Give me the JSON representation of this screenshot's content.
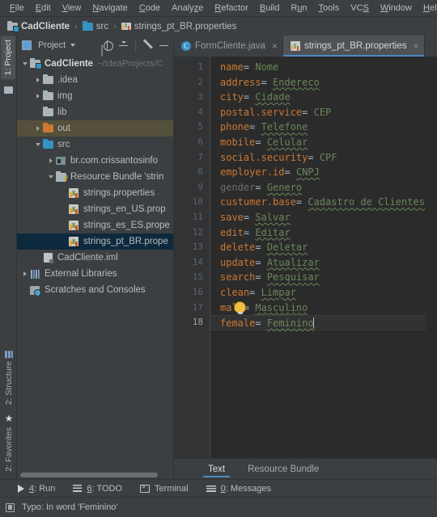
{
  "window": {
    "menu": [
      {
        "label": "File",
        "mnemonic": "F"
      },
      {
        "label": "Edit",
        "mnemonic": "E"
      },
      {
        "label": "View",
        "mnemonic": "V"
      },
      {
        "label": "Navigate",
        "mnemonic": "N"
      },
      {
        "label": "Code",
        "mnemonic": "C"
      },
      {
        "label": "Analyze",
        "mnemonic": "z"
      },
      {
        "label": "Refactor",
        "mnemonic": "R"
      },
      {
        "label": "Build",
        "mnemonic": "B"
      },
      {
        "label": "Run",
        "mnemonic": "u"
      },
      {
        "label": "Tools",
        "mnemonic": "T"
      },
      {
        "label": "VCS",
        "mnemonic": "S"
      },
      {
        "label": "Window",
        "mnemonic": "W"
      },
      {
        "label": "Help",
        "mnemonic": "H"
      }
    ]
  },
  "breadcrumb": {
    "items": [
      {
        "label": "CadCliente",
        "icon": "module-folder-icon"
      },
      {
        "label": "src",
        "icon": "source-folder-icon"
      },
      {
        "label": "strings_pt_BR.properties",
        "icon": "properties-file-icon"
      }
    ],
    "separator": "›"
  },
  "rail": {
    "project_label": "1: Project",
    "project_mnemonic": "1",
    "structure_label": "2: Structure",
    "structure_mnemonic": "2",
    "favorites_label": "2: Favorites",
    "favorites_mnemonic": "2"
  },
  "project_panel": {
    "title": "Project",
    "toolbar": [
      {
        "name": "select-opened-file-icon",
        "label": "Select Opened File"
      },
      {
        "name": "collapse-all-icon",
        "label": "Collapse All"
      },
      {
        "name": "settings-gear-icon",
        "label": "Settings"
      },
      {
        "name": "hide-icon",
        "label": "Hide"
      }
    ],
    "tree": [
      {
        "label": "CadCliente",
        "path": "~/IdeaProjects/C",
        "depth": 0,
        "arrow": "open",
        "icon": "module-folder-icon",
        "bold": true,
        "state": "normal"
      },
      {
        "label": ".idea",
        "path": "",
        "depth": 1,
        "arrow": "closed",
        "icon": "folder-icon",
        "bold": false,
        "state": "normal"
      },
      {
        "label": "img",
        "path": "",
        "depth": 1,
        "arrow": "closed",
        "icon": "folder-icon",
        "bold": false,
        "state": "normal"
      },
      {
        "label": "lib",
        "path": "",
        "depth": 1,
        "arrow": "none",
        "icon": "folder-icon",
        "bold": false,
        "state": "normal"
      },
      {
        "label": "out",
        "path": "",
        "depth": 1,
        "arrow": "closed",
        "icon": "output-folder-icon",
        "bold": false,
        "state": "highlighted"
      },
      {
        "label": "src",
        "path": "",
        "depth": 1,
        "arrow": "open",
        "icon": "source-folder-icon",
        "bold": false,
        "state": "normal"
      },
      {
        "label": "br.com.crissantosinfo",
        "path": "",
        "depth": 2,
        "arrow": "closed",
        "icon": "package-icon",
        "bold": false,
        "state": "normal"
      },
      {
        "label": "Resource Bundle 'strin",
        "path": "",
        "depth": 2,
        "arrow": "open",
        "icon": "resource-bundle-icon",
        "bold": false,
        "state": "normal"
      },
      {
        "label": "strings.properties",
        "path": "",
        "depth": 3,
        "arrow": "none",
        "icon": "properties-file-icon",
        "bold": false,
        "state": "normal"
      },
      {
        "label": "strings_en_US.prop",
        "path": "",
        "depth": 3,
        "arrow": "none",
        "icon": "properties-file-icon",
        "bold": false,
        "state": "normal"
      },
      {
        "label": "strings_es_ES.prope",
        "path": "",
        "depth": 3,
        "arrow": "none",
        "icon": "properties-file-icon",
        "bold": false,
        "state": "normal"
      },
      {
        "label": "strings_pt_BR.prope",
        "path": "",
        "depth": 3,
        "arrow": "none",
        "icon": "properties-file-icon",
        "bold": false,
        "state": "selected"
      },
      {
        "label": "CadCliente.iml",
        "path": "",
        "depth": 1,
        "arrow": "none",
        "icon": "iml-file-icon",
        "bold": false,
        "state": "normal"
      },
      {
        "label": "External Libraries",
        "path": "",
        "depth": 0,
        "arrow": "closed",
        "icon": "libraries-icon",
        "bold": false,
        "state": "normal"
      },
      {
        "label": "Scratches and Consoles",
        "path": "",
        "depth": 0,
        "arrow": "none",
        "icon": "scratches-icon",
        "bold": false,
        "state": "normal"
      }
    ]
  },
  "editor": {
    "tabs": [
      {
        "label": "FormCliente.java",
        "icon": "java-class-icon",
        "active": false,
        "close": "×"
      },
      {
        "label": "strings_pt_BR.properties",
        "icon": "properties-file-icon",
        "active": true,
        "close": "×"
      }
    ],
    "lines": [
      {
        "num": "1",
        "key": "name",
        "value": "Nome",
        "typo": false,
        "dim": false
      },
      {
        "num": "2",
        "key": "address",
        "value": "Endereco",
        "typo": true,
        "dim": false
      },
      {
        "num": "3",
        "key": "city",
        "value": "Cidade",
        "typo": true,
        "dim": false
      },
      {
        "num": "4",
        "key": "postal.service",
        "value": "CEP",
        "typo": false,
        "dim": false
      },
      {
        "num": "5",
        "key": "phone",
        "value": "Telefone",
        "typo": true,
        "dim": false
      },
      {
        "num": "6",
        "key": "mobile",
        "value": "Celular",
        "typo": true,
        "dim": false
      },
      {
        "num": "7",
        "key": "social.security",
        "value": "CPF",
        "typo": false,
        "dim": false
      },
      {
        "num": "8",
        "key": "employer.id",
        "value": "CNPJ",
        "typo": true,
        "dim": false
      },
      {
        "num": "9",
        "key": "gender",
        "value": "Genero",
        "typo": true,
        "dim": true
      },
      {
        "num": "10",
        "key": "custumer.base",
        "value": "Cadastro de Clientes",
        "typo": true,
        "dim": false
      },
      {
        "num": "11",
        "key": "save",
        "value": "Salvar",
        "typo": true,
        "dim": false
      },
      {
        "num": "12",
        "key": "edit",
        "value": "Editar",
        "typo": true,
        "dim": false
      },
      {
        "num": "13",
        "key": "delete",
        "value": "Deletar",
        "typo": true,
        "dim": false
      },
      {
        "num": "14",
        "key": "update",
        "value": "Atualizar",
        "typo": true,
        "dim": false
      },
      {
        "num": "15",
        "key": "search",
        "value": "Pesquisar",
        "typo": true,
        "dim": false
      },
      {
        "num": "16",
        "key": "clean",
        "value": "Limpar",
        "typo": true,
        "dim": false
      },
      {
        "num": "17",
        "key": "male",
        "value": "Masculino",
        "typo": true,
        "dim": false
      },
      {
        "num": "18",
        "key": "female",
        "value": "Feminino",
        "typo": true,
        "dim": false
      }
    ],
    "separator": "=",
    "caret_line": 18,
    "intention_line": 17,
    "intention_icon": "lightbulb-icon",
    "bottom_tabs": [
      {
        "label": "Text",
        "active": true
      },
      {
        "label": "Resource Bundle",
        "active": false
      }
    ]
  },
  "toolbar_bottom": [
    {
      "label": "4: Run",
      "mnemonic": "4",
      "icon": "run-icon"
    },
    {
      "label": "6: TODO",
      "mnemonic": "6",
      "icon": "todo-icon"
    },
    {
      "label": "Terminal",
      "mnemonic": "",
      "icon": "terminal-icon"
    },
    {
      "label": "0: Messages",
      "mnemonic": "0",
      "icon": "messages-icon"
    }
  ],
  "statusbar": {
    "message": "Typo: In word 'Feminino'",
    "icon": "inspection-icon"
  },
  "colors": {
    "background": "#3c3f41",
    "editor_background": "#2b2b2b",
    "gutter": "#313335",
    "accent_blue": "#4a88c7",
    "selection": "#0d293e",
    "highlight_row": "#54503b",
    "key_orange": "#cc7832",
    "value_green": "#6a8759",
    "text": "#bbbbbb"
  }
}
